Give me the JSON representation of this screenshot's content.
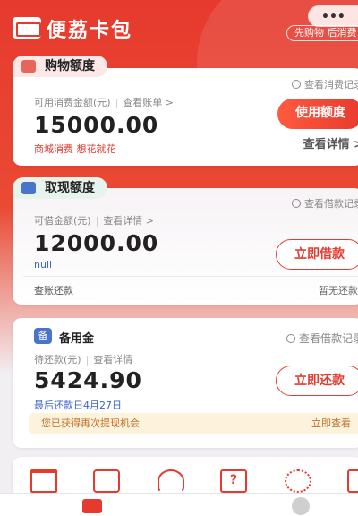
{
  "header": {
    "app_title": "便荔卡包",
    "capsule_dots": "•••",
    "tagline": "先购物 后消费"
  },
  "shopping": {
    "chip": "购物额度",
    "record_link": "查看消费记录",
    "available_label": "可用消费金额(元)",
    "bill_link": "查看账单 >",
    "amount": "15000.00",
    "promo": "商城消费  想花就花",
    "button": "使用额度",
    "detail_link": "查看详情 >"
  },
  "cash": {
    "chip": "取现额度",
    "record_link": "查看借款记录",
    "available_label": "可借金额(元)",
    "detail_link": "查看详情 >",
    "amount": "12000.00",
    "sub": "null",
    "button": "立即借款",
    "footer_left": "查账还款",
    "footer_right": "暂无还款"
  },
  "reserve": {
    "badge": "备",
    "title": "备用金",
    "record_link": "查看借款记录",
    "pending_label": "待还款(元)",
    "detail_link": "查看详情",
    "amount": "5424.90",
    "last_date": "最后还款日4月27日",
    "button": "立即还款",
    "banner_text": "您已获得再次提现机会",
    "banner_action": "立即查看"
  },
  "services": {
    "icon_4_glyph": "?"
  },
  "colors": {
    "accent": "#e63a2e",
    "blue": "#3a63c8",
    "banner": "#fdf3dc"
  }
}
